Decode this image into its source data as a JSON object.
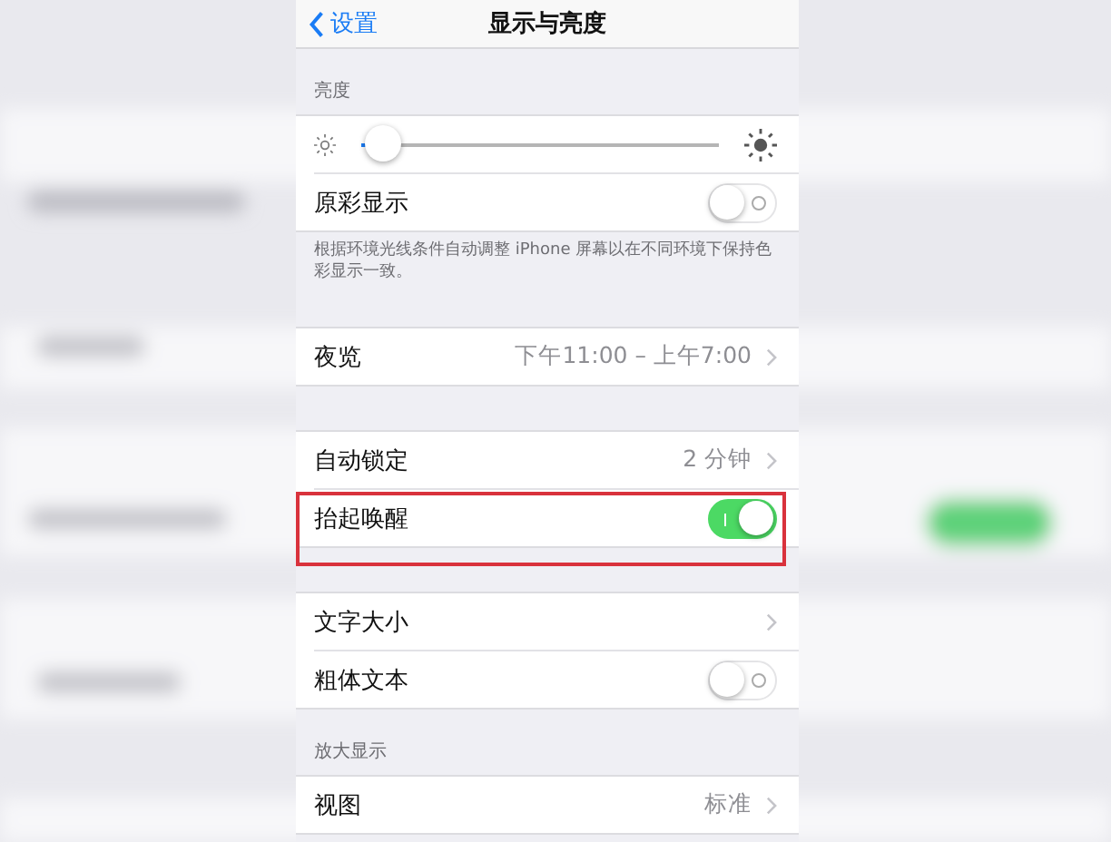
{
  "nav": {
    "back": "设置",
    "title": "显示与亮度"
  },
  "groups": [
    {
      "header": "亮度",
      "rows": [
        {
          "kind": "slider",
          "level": 0.06
        },
        {
          "kind": "switch",
          "label": "原彩显示",
          "on": false,
          "highlighted": false
        }
      ],
      "footer": "根据环境光线条件自动调整 iPhone 屏幕以在不同环境下保持色彩显示一致。"
    },
    {
      "rows": [
        {
          "kind": "value",
          "label": "夜览",
          "value": "下午11:00 – 上午7:00",
          "highlighted": false
        }
      ]
    },
    {
      "rows": [
        {
          "kind": "value",
          "label": "自动锁定",
          "value": "2 分钟",
          "highlighted": false
        },
        {
          "kind": "switch",
          "label": "抬起唤醒",
          "on": true,
          "highlighted": true
        }
      ]
    },
    {
      "rows": [
        {
          "kind": "value",
          "label": "文字大小",
          "highlighted": false
        },
        {
          "kind": "switch",
          "label": "粗体文本",
          "on": false,
          "highlighted": false
        }
      ]
    },
    {
      "header": "放大显示",
      "rows": [
        {
          "kind": "value",
          "label": "视图",
          "value": "标准",
          "highlighted": false
        }
      ]
    }
  ]
}
